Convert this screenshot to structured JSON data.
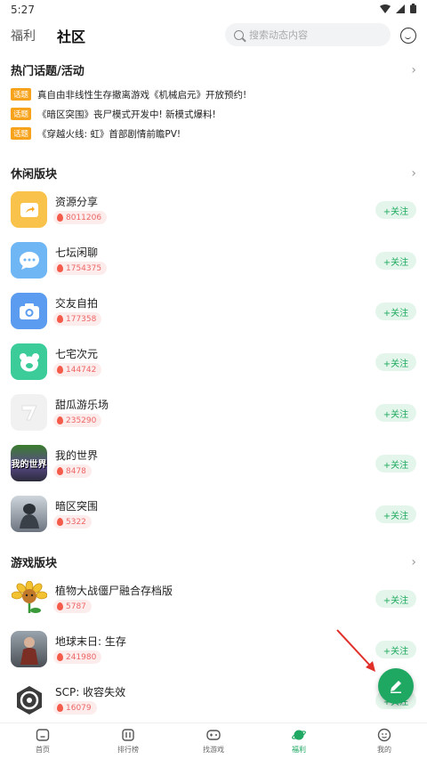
{
  "status": {
    "time": "5:27"
  },
  "tabs": [
    {
      "label": "福利"
    },
    {
      "label": "社区"
    }
  ],
  "search": {
    "placeholder": "搜索动态内容"
  },
  "topics_section": {
    "title": "热门话题/活动",
    "items": [
      {
        "tag": "话题",
        "text": "真自由非线性生存撤离游戏《机械启元》开放预约!"
      },
      {
        "tag": "话题",
        "text": "《暗区突围》丧尸模式开发中! 新模式爆料!"
      },
      {
        "tag": "话题",
        "text": "《穿越火线: 虹》首部剧情前瞻PV!"
      }
    ]
  },
  "casual_section": {
    "title": "休闲版块",
    "boards": [
      {
        "name": "资源分享",
        "heat": "8011206",
        "icon": "share-icon"
      },
      {
        "name": "七坛闲聊",
        "heat": "1754375",
        "icon": "chat-icon"
      },
      {
        "name": "交友自拍",
        "heat": "177358",
        "icon": "camera-icon"
      },
      {
        "name": "七宅次元",
        "heat": "144742",
        "icon": "bear-icon"
      },
      {
        "name": "甜瓜游乐场",
        "heat": "235290",
        "icon": "melon-playground-icon"
      },
      {
        "name": "我的世界",
        "heat": "8478",
        "icon": "minecraft-icon"
      },
      {
        "name": "暗区突围",
        "heat": "5322",
        "icon": "arena-breakout-icon"
      }
    ]
  },
  "game_section": {
    "title": "游戏版块",
    "boards": [
      {
        "name": "植物大战僵尸融合存档版",
        "heat": "5787",
        "icon": "pvz-icon"
      },
      {
        "name": "地球末日: 生存",
        "heat": "241980",
        "icon": "last-day-icon"
      },
      {
        "name": "SCP: 收容失效",
        "heat": "16079",
        "icon": "scp-icon"
      }
    ]
  },
  "follow_label": "+关注",
  "minecraft_icon_text": "我的世界",
  "bottom_nav": [
    {
      "label": "首页",
      "icon": "home-icon"
    },
    {
      "label": "排行榜",
      "icon": "ranking-icon"
    },
    {
      "label": "找游戏",
      "icon": "gamepad-icon"
    },
    {
      "label": "福利",
      "icon": "planet-icon"
    },
    {
      "label": "我的",
      "icon": "profile-icon"
    }
  ],
  "colors": {
    "accent": "#1ea862",
    "topic_tag": "#f7a21b",
    "heat": "#ee6666"
  }
}
